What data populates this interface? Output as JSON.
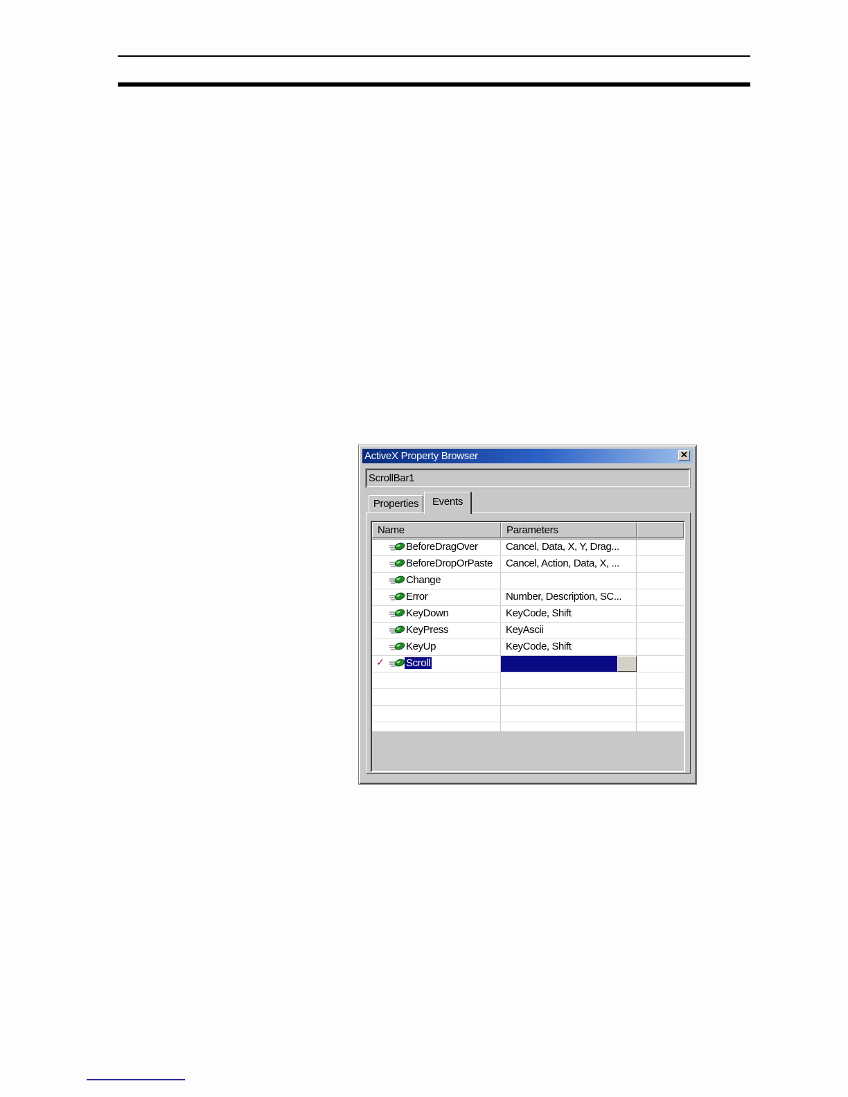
{
  "window": {
    "title": "ActiveX Property Browser",
    "close_glyph": "✕",
    "object_name": "ScrollBar1"
  },
  "tabs": [
    {
      "label": "Properties",
      "active": false
    },
    {
      "label": "Events",
      "active": true
    }
  ],
  "table": {
    "columns": [
      "Name",
      "Parameters",
      ""
    ],
    "rows": [
      {
        "name": "BeforeDragOver",
        "params": "Cancel, Data, X, Y, Drag...",
        "icon": "event-icon",
        "checked": false,
        "selected": false
      },
      {
        "name": "BeforeDropOrPaste",
        "params": "Cancel, Action, Data, X, ...",
        "icon": "event-icon",
        "checked": false,
        "selected": false
      },
      {
        "name": "Change",
        "params": "",
        "icon": "event-icon",
        "checked": false,
        "selected": false
      },
      {
        "name": "Error",
        "params": "Number, Description, SC...",
        "icon": "event-icon",
        "checked": false,
        "selected": false
      },
      {
        "name": "KeyDown",
        "params": "KeyCode, Shift",
        "icon": "event-icon",
        "checked": false,
        "selected": false
      },
      {
        "name": "KeyPress",
        "params": "KeyAscii",
        "icon": "event-icon",
        "checked": false,
        "selected": false
      },
      {
        "name": "KeyUp",
        "params": "KeyCode, Shift",
        "icon": "event-icon",
        "checked": false,
        "selected": false
      },
      {
        "name": "Scroll",
        "params": "",
        "icon": "event-icon",
        "checked": true,
        "selected": true
      }
    ],
    "check_glyph": "✓"
  },
  "colors": {
    "selection": "#0a0a84",
    "titlebar_start": "#082a7c",
    "titlebar_end": "#9fc0ea",
    "check": "#c00030"
  }
}
